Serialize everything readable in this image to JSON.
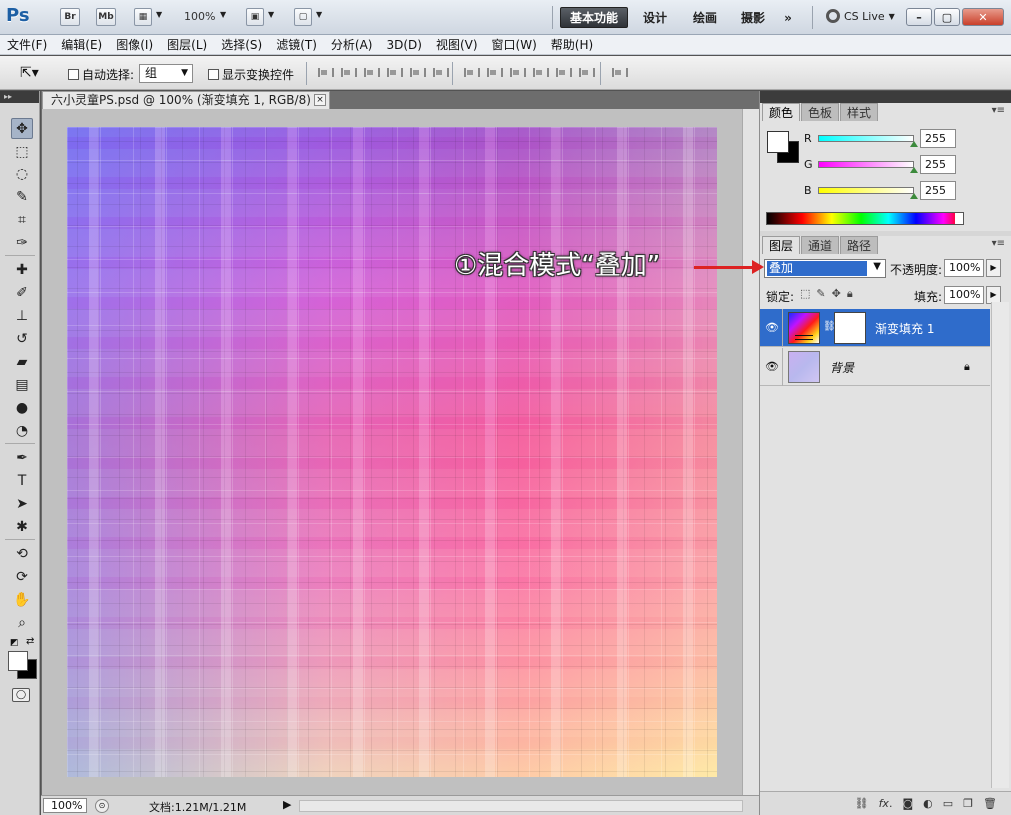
{
  "appbar": {
    "logo": "Ps",
    "bridge": "Br",
    "minibridge": "Mb",
    "zoom": "100%",
    "workspaces": [
      "基本功能",
      "设计",
      "绘画",
      "摄影"
    ],
    "more": "»",
    "cslive": "CS Live"
  },
  "menu": [
    "文件(F)",
    "编辑(E)",
    "图像(I)",
    "图层(L)",
    "选择(S)",
    "滤镜(T)",
    "分析(A)",
    "3D(D)",
    "视图(V)",
    "窗口(W)",
    "帮助(H)"
  ],
  "options": {
    "auto_select_label": "自动选择:",
    "auto_select_value": "组",
    "show_transform_label": "显示变换控件"
  },
  "document": {
    "tab_title": "六小灵童PS.psd @ 100% (渐变填充 1, RGB/8) *",
    "close": "×"
  },
  "statusbar": {
    "zoom": "100%",
    "doc_info": "文档:1.21M/1.21M"
  },
  "color_panel": {
    "tabs": [
      "颜色",
      "色板",
      "样式"
    ],
    "channels": [
      {
        "label": "R",
        "value": "255",
        "color": "#00ffff"
      },
      {
        "label": "G",
        "value": "255",
        "color": "#ff00ff"
      },
      {
        "label": "B",
        "value": "255",
        "color": "#ffff00"
      }
    ]
  },
  "layers_panel": {
    "tabs": [
      "图层",
      "通道",
      "路径"
    ],
    "blend_mode": "叠加",
    "opacity_label": "不透明度:",
    "opacity_value": "100%",
    "lock_label": "锁定:",
    "fill_label": "填充:",
    "fill_value": "100%",
    "layers": [
      {
        "name": "渐变填充 1",
        "selected": true
      },
      {
        "name": "背景",
        "selected": false
      }
    ]
  },
  "annotation": {
    "text": "①混合模式“叠加”"
  }
}
